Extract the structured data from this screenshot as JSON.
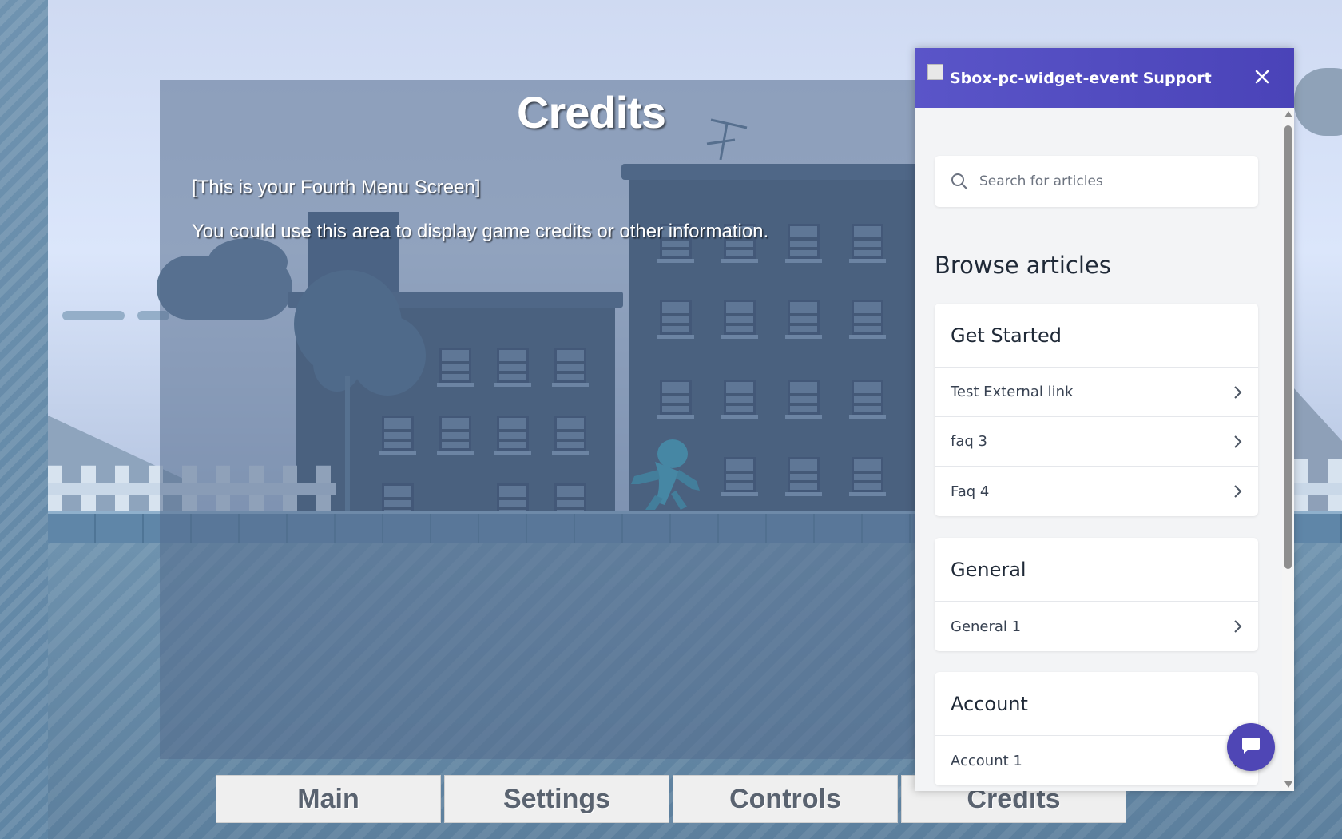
{
  "overlay": {
    "title": "Credits",
    "line1": "[This is your Fourth Menu Screen]",
    "line2": "You could use this area to display game credits or other information."
  },
  "menu": {
    "buttons": [
      "Main",
      "Settings",
      "Controls",
      "Credits"
    ],
    "active": "Credits"
  },
  "widget": {
    "title": "Sbox-pc-widget-event Support",
    "search_placeholder": "Search for articles",
    "browse_heading": "Browse articles",
    "categories": [
      {
        "title": "Get Started",
        "items": [
          "Test External link",
          "faq 3",
          "Faq 4"
        ]
      },
      {
        "title": "General",
        "items": [
          "General 1"
        ]
      },
      {
        "title": "Account",
        "items": [
          "Account 1"
        ]
      }
    ],
    "header_color": "#4a43b8",
    "icons": {
      "close": "close-icon",
      "search": "search-icon",
      "item": "chevron-right-icon",
      "chat": "chat-bubble-icon",
      "logo": "broken-image-icon"
    }
  }
}
